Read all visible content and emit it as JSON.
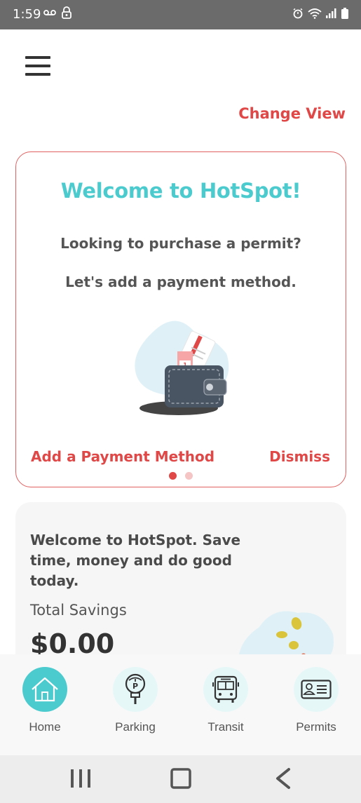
{
  "status_bar": {
    "time": "1:59",
    "left_icons": [
      "voicemail-icon",
      "lock-icon"
    ],
    "right_icons": [
      "alarm-icon",
      "wifi-icon",
      "signal-icon",
      "battery-icon"
    ]
  },
  "header": {
    "menu_icon": "hamburger-menu-icon",
    "change_view": "Change View"
  },
  "welcome_card": {
    "title": "Welcome to HotSpot!",
    "line1": "Looking to purchase a permit?",
    "line2": "Let's add a payment method.",
    "illustration": "wallet-illustration",
    "add_payment": "Add a Payment Method",
    "dismiss": "Dismiss",
    "pager": {
      "total": 2,
      "active": 1
    }
  },
  "savings_card": {
    "welcome": "Welcome to HotSpot. Save time, money and do good today.",
    "label": "Total Savings",
    "amount": "$0.00",
    "illustration": "coins-illustration"
  },
  "bottom_nav": {
    "items": [
      {
        "label": "Home",
        "icon": "home-icon",
        "active": true
      },
      {
        "label": "Parking",
        "icon": "parking-meter-icon",
        "active": false
      },
      {
        "label": "Transit",
        "icon": "bus-icon",
        "active": false
      },
      {
        "label": "Permits",
        "icon": "permit-card-icon",
        "active": false
      }
    ]
  },
  "system_nav": {
    "buttons": [
      "recent-apps-icon",
      "home-button-icon",
      "back-icon"
    ]
  },
  "colors": {
    "accent_teal": "#4ccbcf",
    "accent_red": "#e04848",
    "status_bar": "#6b6b6b"
  }
}
